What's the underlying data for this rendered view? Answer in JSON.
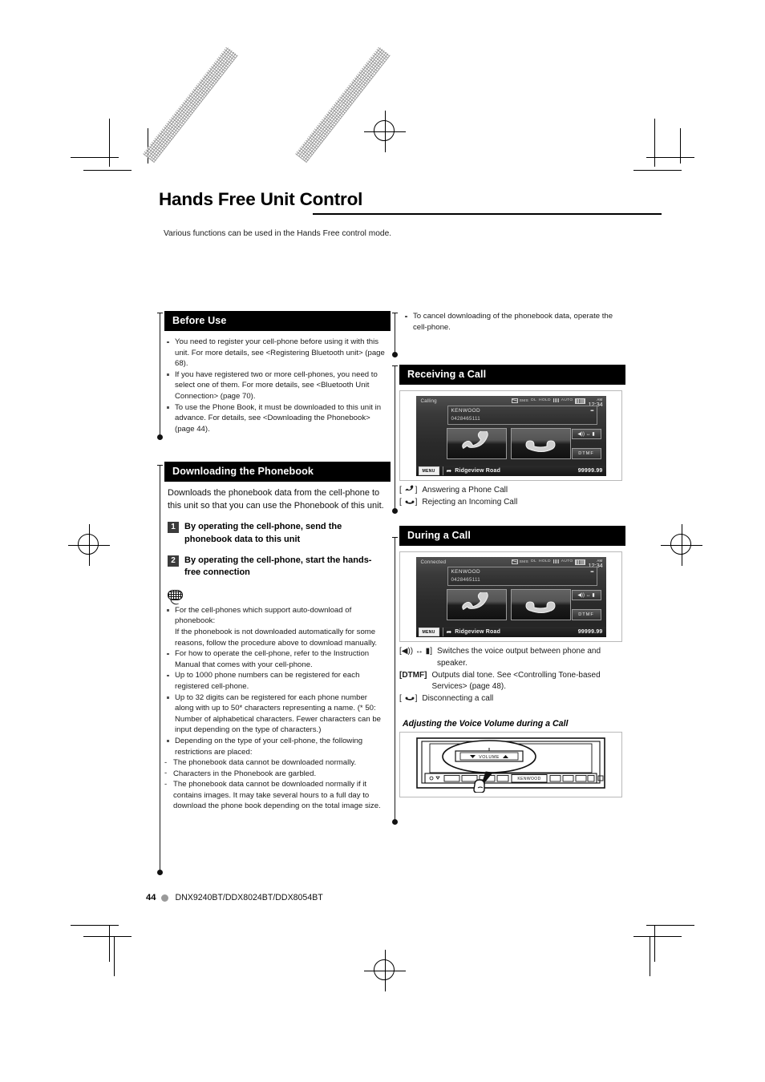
{
  "document": {
    "chapter_title": "Hands Free Unit Control",
    "lead": "Various functions can be used in the Hands Free control mode.",
    "page_number": "44",
    "models": "DNX9240BT/DDX8024BT/DDX8054BT"
  },
  "left_column": {
    "before_use": {
      "heading": "Before Use",
      "bullets": [
        "You need to register your cell-phone before using it with this unit. For more details, see <Registering Bluetooth unit> (page 68).",
        "If you have registered two or more cell-phones, you need to select one of them. For more details, see <Bluetooth Unit Connection> (page 70).",
        "To use the Phone Book, it must be downloaded to this unit in advance. For details, see <Downloading the Phonebook> (page 44)."
      ]
    },
    "downloading": {
      "heading": "Downloading the Phonebook",
      "intro": "Downloads the phonebook data from the cell-phone to this unit so that you can use the Phonebook of this unit.",
      "steps": [
        {
          "num": "1",
          "text": "By operating the cell-phone, send the phonebook data to this unit"
        },
        {
          "num": "2",
          "text": "By operating the cell-phone, start the hands-free connection"
        }
      ],
      "note_icon": "note-balloon-icon",
      "notes": [
        "For the cell-phones which support auto-download of phonebook:",
        "If the phonebook is not downloaded automatically for some reasons, follow the procedure above to download manually.",
        "For how to operate the cell-phone, refer to the Instruction Manual that comes with your cell-phone.",
        "Up to 1000 phone numbers can be registered for each registered cell-phone.",
        "Up to 32 digits can be registered for each phone number along with up to 50* characters representing a name. (* 50: Number of alphabetical characters. Fewer characters can be input depending on the type of characters.)",
        "Depending on the type of your cell-phone, the following restrictions are placed:"
      ],
      "restrictions": [
        "The phonebook data cannot be downloaded normally.",
        "Characters in the Phonebook are garbled.",
        "The phonebook data cannot be downloaded normally if it contains images. It may take several hours to a full day to download the phone book depending on the total image size."
      ]
    }
  },
  "right_column": {
    "top_note": "To cancel downloading of the phonebook data, operate the cell-phone.",
    "receiving": {
      "heading": "Receiving a Call",
      "screen": {
        "state": "Calling",
        "status": {
          "sms": "SMS",
          "dl": "DL",
          "hold": "HOLD",
          "auto": "AUTO",
          "clock": "12:34",
          "ampm": "AM"
        },
        "caller_name": "KENWOOD",
        "caller_number": "0428465111",
        "side_key_dtmf": "DTMF",
        "menu": "MENU",
        "road": "Ridgeview Road",
        "odometer": "99999.99"
      },
      "legend": [
        {
          "icon": "handset-answer-icon",
          "label": "Answering a Phone Call"
        },
        {
          "icon": "handset-reject-icon",
          "label": "Rejecting an Incoming Call"
        }
      ]
    },
    "during": {
      "heading": "During a Call",
      "screen": {
        "state": "Connected",
        "status": {
          "sms": "SMS",
          "dl": "DL",
          "hold": "HOLD",
          "auto": "AUTO",
          "clock": "12:34",
          "ampm": "AM"
        },
        "caller_name": "KENWOOD",
        "caller_number": "0428465111",
        "side_key_dtmf": "DTMF",
        "menu": "MENU",
        "road": "Ridgeview Road",
        "odometer": "99999.99"
      },
      "legend": [
        {
          "icon": "speaker-switch-icon",
          "key": "",
          "label": "Switches the voice output between phone and speaker."
        },
        {
          "icon": "",
          "key": "[DTMF]",
          "label": "Outputs dial tone.  See <Controlling Tone-based Services> (page 48)."
        },
        {
          "icon": "handset-reject-icon",
          "key": "",
          "label": "Disconnecting a call"
        }
      ]
    },
    "adjusting": {
      "heading": "Adjusting the Voice Volume during a Call",
      "volume_label": "VOLUME",
      "brand": "KENWOOD"
    }
  },
  "colors": {
    "section_header_bg": "#000000",
    "section_header_text": "#ffffff",
    "step_badge_bg": "#3b3b3b",
    "footer_dot": "#9a9a9a"
  }
}
